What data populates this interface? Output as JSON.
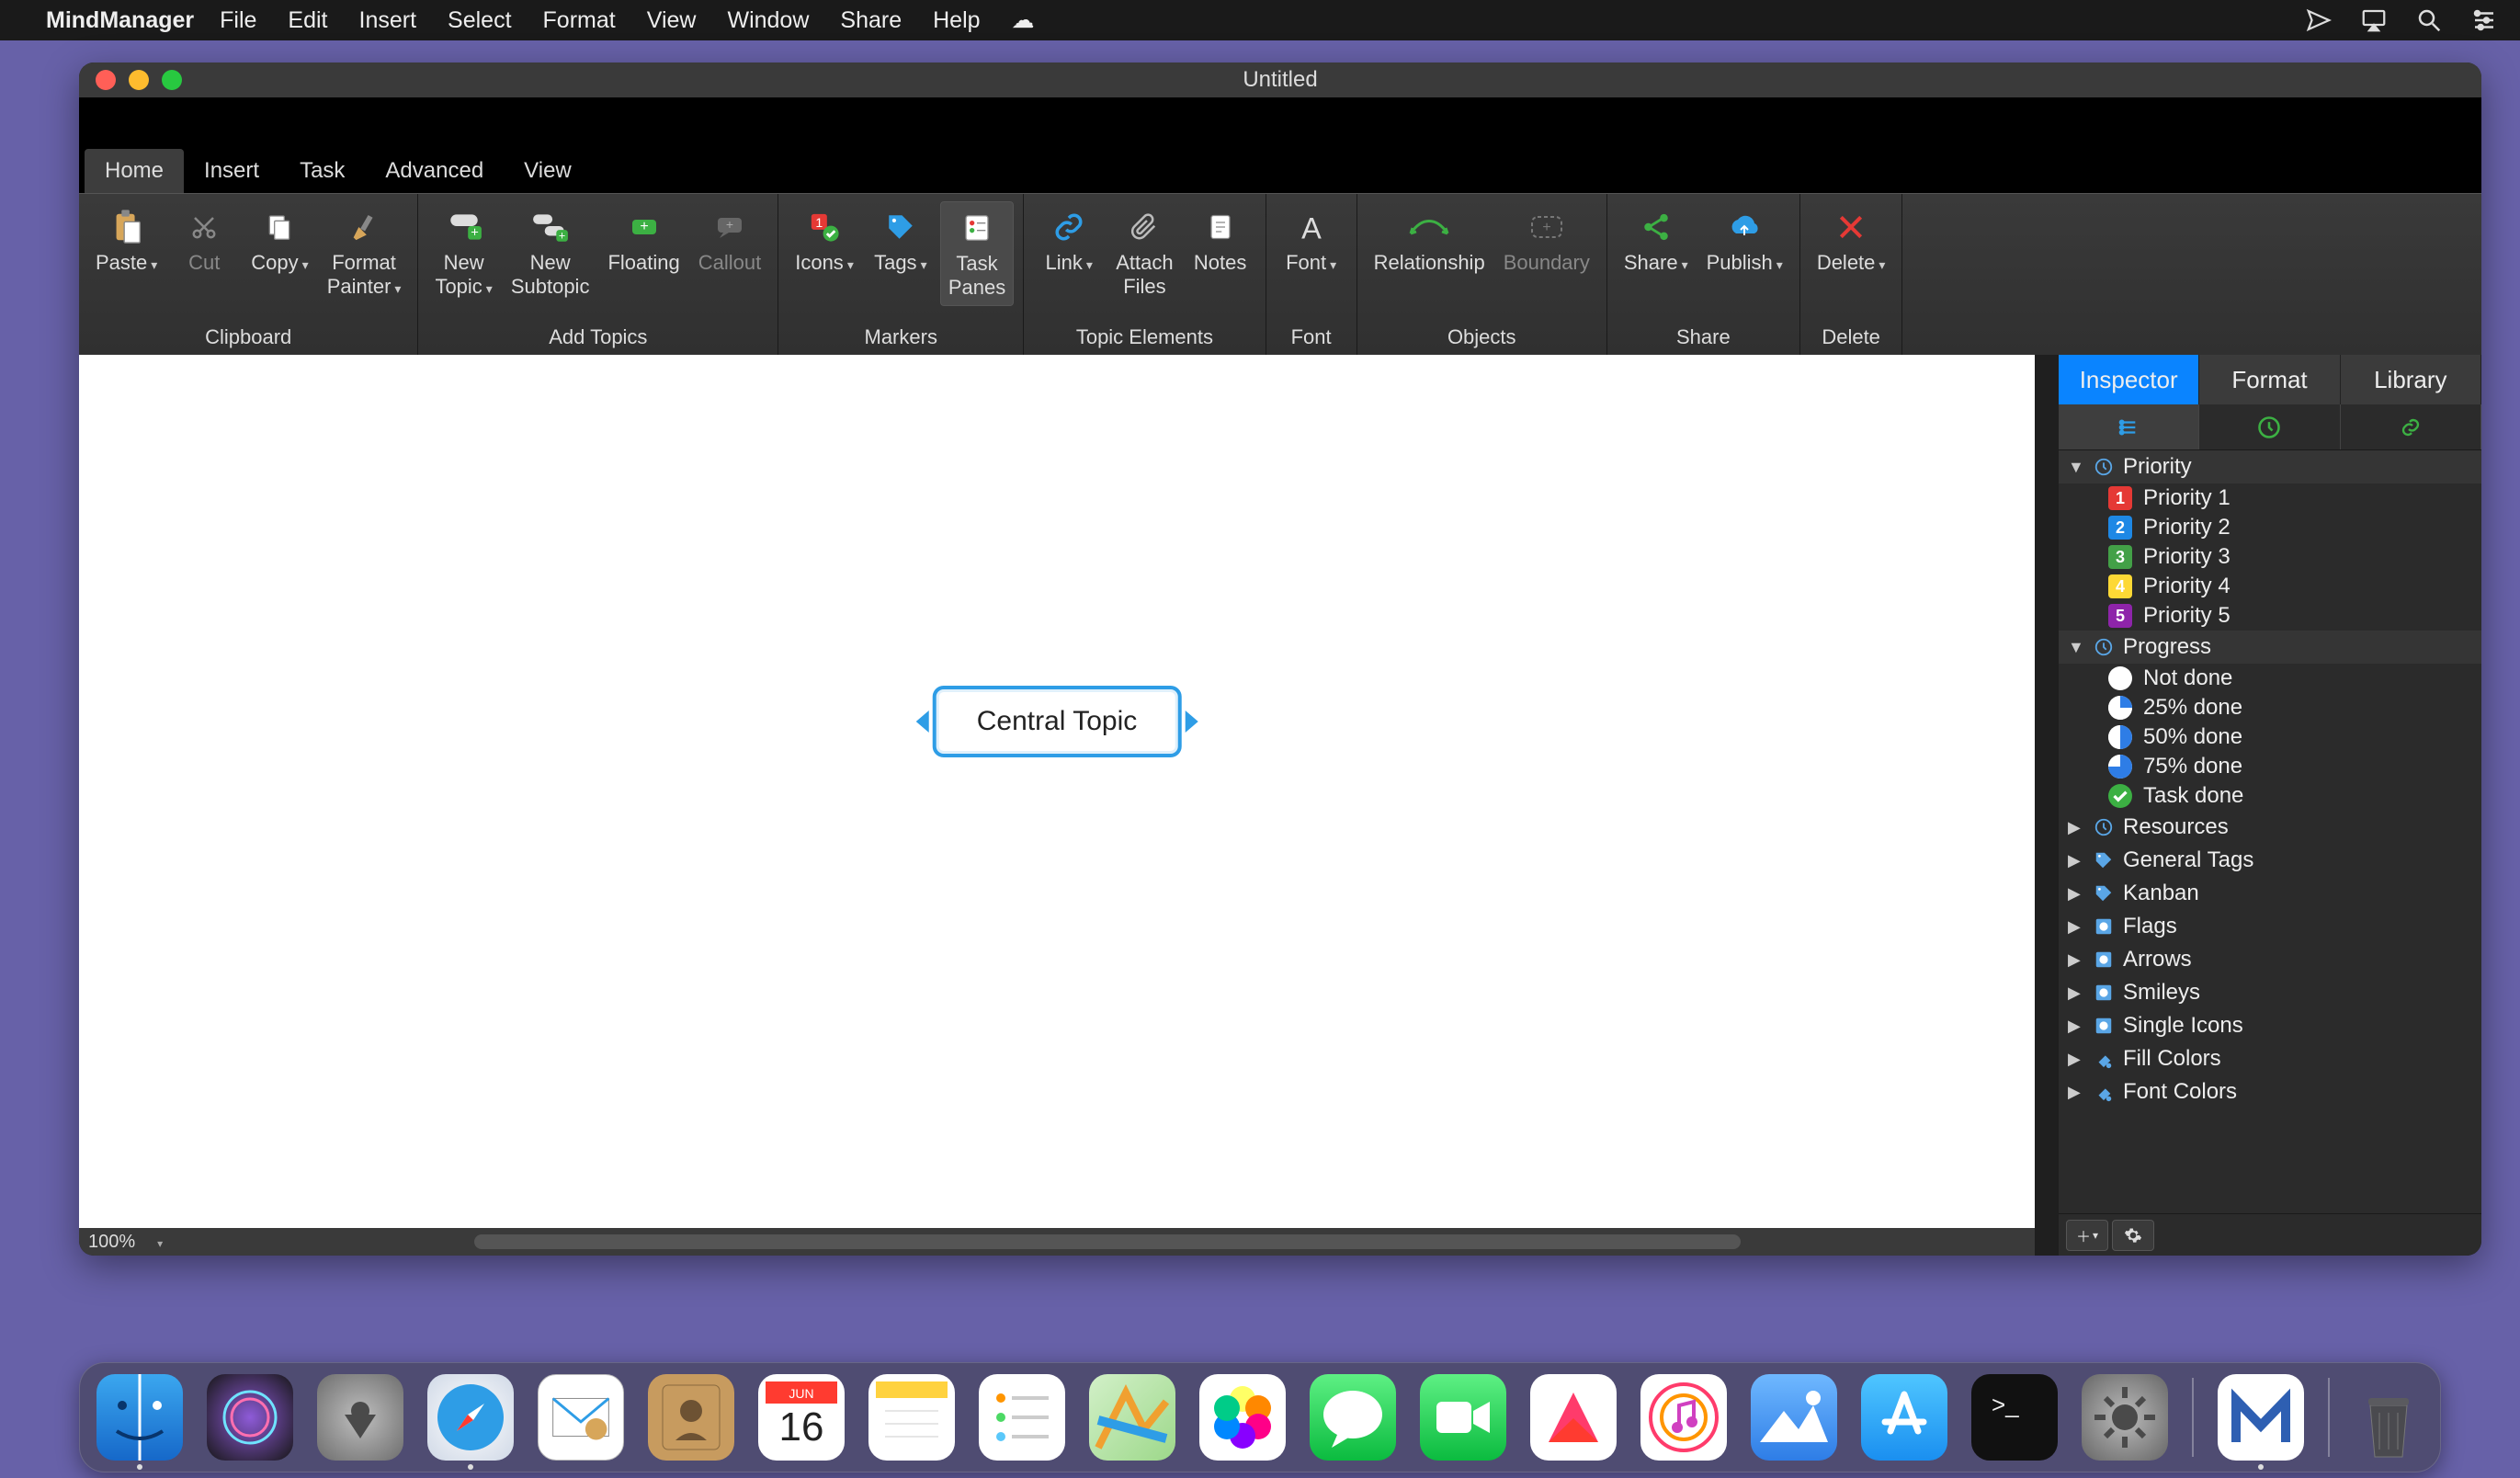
{
  "menubar": {
    "app": "MindManager",
    "items": [
      "File",
      "Edit",
      "Insert",
      "Select",
      "Format",
      "View",
      "Window",
      "Share",
      "Help"
    ]
  },
  "window": {
    "title": "Untitled"
  },
  "ribbon_tabs": [
    "Home",
    "Insert",
    "Task",
    "Advanced",
    "View"
  ],
  "ribbon_active_tab": "Home",
  "ribbon": {
    "clipboard": {
      "label": "Clipboard",
      "paste": "Paste",
      "cut": "Cut",
      "copy": "Copy",
      "format_painter": "Format\nPainter"
    },
    "add_topics": {
      "label": "Add Topics",
      "new_topic": "New\nTopic",
      "new_subtopic": "New\nSubtopic",
      "floating": "Floating",
      "callout": "Callout"
    },
    "markers": {
      "label": "Markers",
      "icons": "Icons",
      "tags": "Tags",
      "task_panes": "Task\nPanes"
    },
    "topic_elements": {
      "label": "Topic Elements",
      "link": "Link",
      "attach": "Attach\nFiles",
      "notes": "Notes"
    },
    "font": {
      "label": "Font",
      "font": "Font"
    },
    "objects": {
      "label": "Objects",
      "relationship": "Relationship",
      "boundary": "Boundary"
    },
    "share": {
      "label": "Share",
      "share": "Share",
      "publish": "Publish"
    },
    "delete": {
      "label": "Delete",
      "delete": "Delete"
    }
  },
  "canvas": {
    "central_topic": "Central Topic",
    "zoom": "100%"
  },
  "sidepanel": {
    "tabs": [
      "Inspector",
      "Format",
      "Library"
    ],
    "active_tab": "Inspector",
    "groups": {
      "priority": {
        "label": "Priority",
        "items": [
          "Priority 1",
          "Priority 2",
          "Priority 3",
          "Priority 4",
          "Priority 5"
        ],
        "colors": [
          "#e53935",
          "#1e88e5",
          "#43a047",
          "#fdd835",
          "#8e24aa"
        ]
      },
      "progress": {
        "label": "Progress",
        "items": [
          "Not done",
          "25% done",
          "50% done",
          "75% done",
          "Task done"
        ]
      },
      "others": [
        "Resources",
        "General Tags",
        "Kanban",
        "Flags",
        "Arrows",
        "Smileys",
        "Single Icons",
        "Fill Colors",
        "Font Colors"
      ]
    }
  }
}
